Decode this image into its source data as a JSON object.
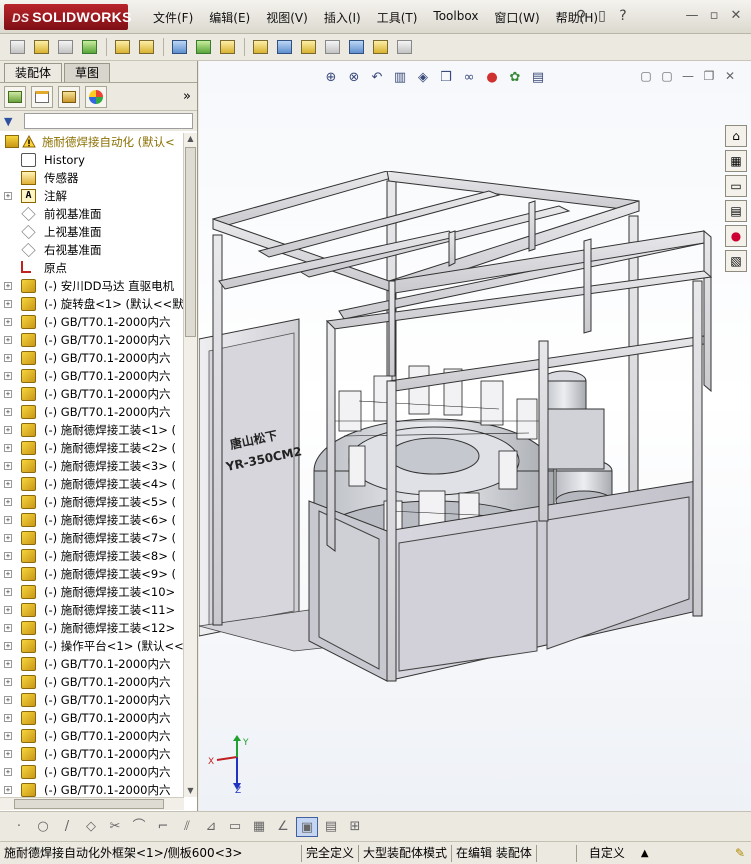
{
  "app": {
    "logo_prefix": "DS",
    "logo_text": "SOLIDWORKS"
  },
  "menu": [
    "文件(F)",
    "编辑(E)",
    "视图(V)",
    "插入(I)",
    "工具(T)",
    "Toolbox",
    "窗口(W)",
    "帮助(H)"
  ],
  "tabs": {
    "assembly": "装配体",
    "sketch": "草图"
  },
  "filter": {
    "label": "▼"
  },
  "tree": {
    "root": "施耐德焊接自动化  (默认<",
    "items": [
      {
        "label": "History",
        "icon": "history-icon",
        "exp": false
      },
      {
        "label": "传感器",
        "icon": "sensor-icon",
        "exp": false
      },
      {
        "label": "注解",
        "icon": "annotation-icon",
        "exp": true
      },
      {
        "label": "前视基准面",
        "icon": "plane-icon",
        "exp": false
      },
      {
        "label": "上视基准面",
        "icon": "plane-icon",
        "exp": false
      },
      {
        "label": "右视基准面",
        "icon": "plane-icon",
        "exp": false
      },
      {
        "label": "原点",
        "icon": "origin-icon",
        "exp": false
      },
      {
        "label": "(-) 安川DD马达 直驱电机",
        "icon": "part-icon",
        "exp": true
      },
      {
        "label": "(-) 旋转盘<1> (默认<<默",
        "icon": "part-icon",
        "exp": true
      },
      {
        "label": "(-) GB/T70.1-2000内六",
        "icon": "part-icon",
        "exp": true
      },
      {
        "label": "(-) GB/T70.1-2000内六",
        "icon": "part-icon",
        "exp": true
      },
      {
        "label": "(-) GB/T70.1-2000内六",
        "icon": "part-icon",
        "exp": true
      },
      {
        "label": "(-) GB/T70.1-2000内六",
        "icon": "part-icon",
        "exp": true
      },
      {
        "label": "(-) GB/T70.1-2000内六",
        "icon": "part-icon",
        "exp": true
      },
      {
        "label": "(-) GB/T70.1-2000内六",
        "icon": "part-icon",
        "exp": true
      },
      {
        "label": "(-) 施耐德焊接工装<1> (",
        "icon": "part-icon",
        "exp": true
      },
      {
        "label": "(-) 施耐德焊接工装<2> (",
        "icon": "part-icon",
        "exp": true
      },
      {
        "label": "(-) 施耐德焊接工装<3> (",
        "icon": "part-icon",
        "exp": true
      },
      {
        "label": "(-) 施耐德焊接工装<4> (",
        "icon": "part-icon",
        "exp": true
      },
      {
        "label": "(-) 施耐德焊接工装<5> (",
        "icon": "part-icon",
        "exp": true
      },
      {
        "label": "(-) 施耐德焊接工装<6> (",
        "icon": "part-icon",
        "exp": true
      },
      {
        "label": "(-) 施耐德焊接工装<7> (",
        "icon": "part-icon",
        "exp": true
      },
      {
        "label": "(-) 施耐德焊接工装<8> (",
        "icon": "part-icon",
        "exp": true
      },
      {
        "label": "(-) 施耐德焊接工装<9> (",
        "icon": "part-icon",
        "exp": true
      },
      {
        "label": "(-) 施耐德焊接工装<10>",
        "icon": "part-icon",
        "exp": true
      },
      {
        "label": "(-) 施耐德焊接工装<11>",
        "icon": "part-icon",
        "exp": true
      },
      {
        "label": "(-) 施耐德焊接工装<12>",
        "icon": "part-icon",
        "exp": true
      },
      {
        "label": "(-) 操作平台<1> (默认<<",
        "icon": "part-icon",
        "exp": true
      },
      {
        "label": "(-) GB/T70.1-2000内六",
        "icon": "part-icon",
        "exp": true
      },
      {
        "label": "(-) GB/T70.1-2000内六",
        "icon": "part-icon",
        "exp": true
      },
      {
        "label": "(-) GB/T70.1-2000内六",
        "icon": "part-icon",
        "exp": true
      },
      {
        "label": "(-) GB/T70.1-2000内六",
        "icon": "part-icon",
        "exp": true
      },
      {
        "label": "(-) GB/T70.1-2000内六",
        "icon": "part-icon",
        "exp": true
      },
      {
        "label": "(-) GB/T70.1-2000内六",
        "icon": "part-icon",
        "exp": true
      },
      {
        "label": "(-) GB/T70.1-2000内六",
        "icon": "part-icon",
        "exp": true
      },
      {
        "label": "(-) GB/T70.1-2000内六",
        "icon": "part-icon",
        "exp": true
      }
    ]
  },
  "model": {
    "panel_brand": "唐山松下",
    "panel_model": "YR-350CM2"
  },
  "triad": {
    "x": "X",
    "y": "Y",
    "z": "Z"
  },
  "status": {
    "path": "施耐德焊接自动化外框架<1>/侧板600<3>",
    "definition": "完全定义",
    "mode": "大型装配体模式",
    "editing": "在编辑 装配体",
    "units": "自定义"
  }
}
